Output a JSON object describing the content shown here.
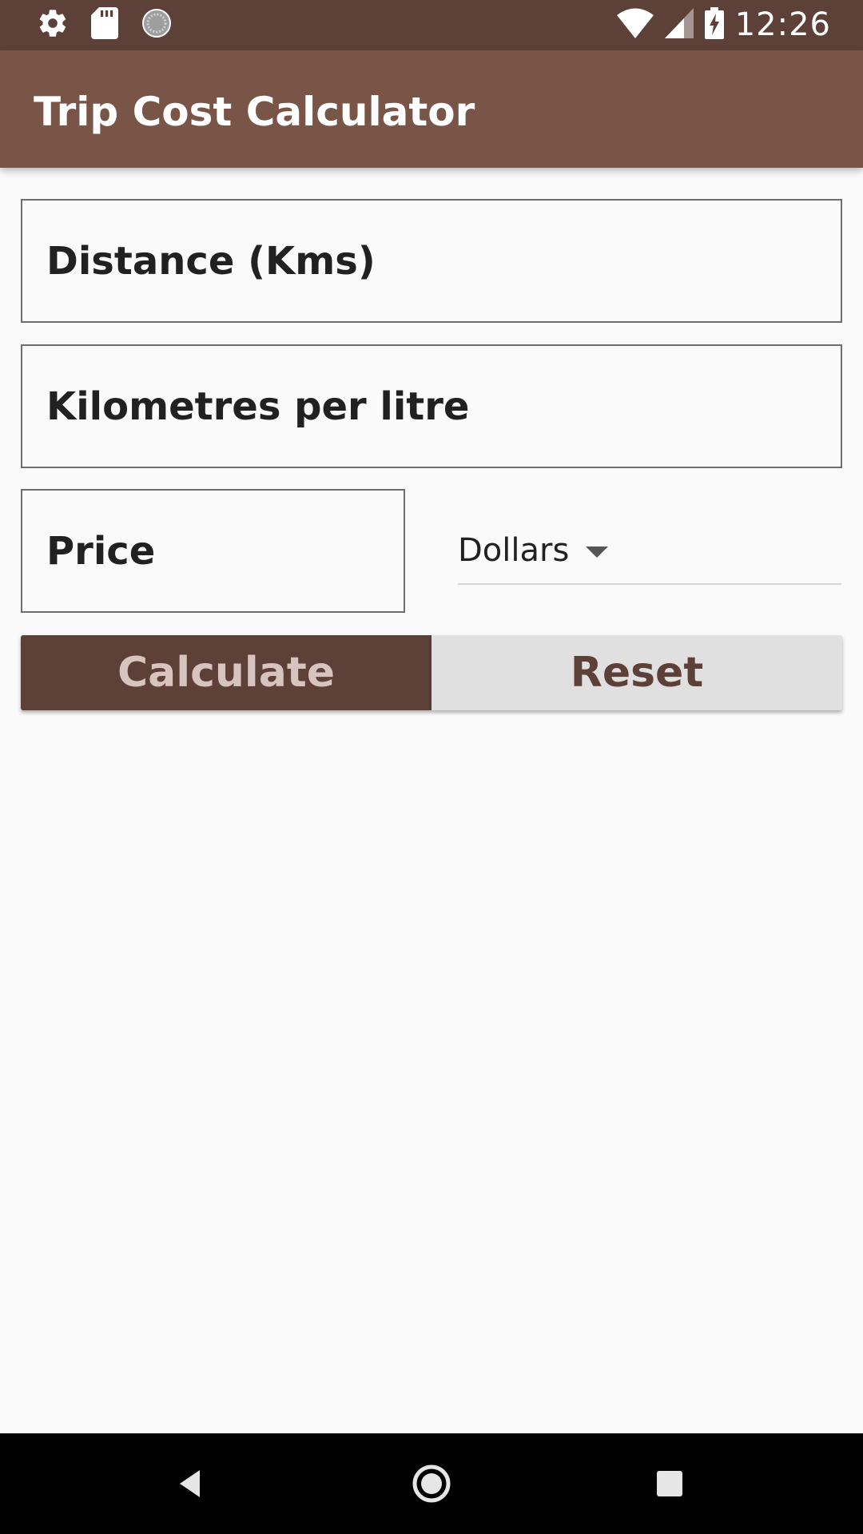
{
  "status_bar": {
    "time": "12:26",
    "left_icons": [
      "gear-icon",
      "sd-card-icon",
      "loading-circle-icon"
    ],
    "right_icons": [
      "wifi-icon",
      "signal-icon",
      "battery-charging-icon"
    ]
  },
  "app_bar": {
    "title": "Trip Cost Calculator"
  },
  "form": {
    "distance_placeholder": "Distance (Kms)",
    "distance_value": "",
    "kmpl_placeholder": "Kilometres per litre",
    "kmpl_value": "",
    "price_placeholder": "Price",
    "price_value": "",
    "currency_selected": "Dollars"
  },
  "buttons": {
    "calculate_label": "Calculate",
    "reset_label": "Reset"
  },
  "nav_bar": {
    "icons": [
      "back-icon",
      "home-icon",
      "recents-icon"
    ]
  },
  "colors": {
    "status_bar": "#5d4037",
    "app_bar": "#795548",
    "primary_button": "#5d4037",
    "secondary_button": "#e0e0e0",
    "background": "#fafafa"
  }
}
